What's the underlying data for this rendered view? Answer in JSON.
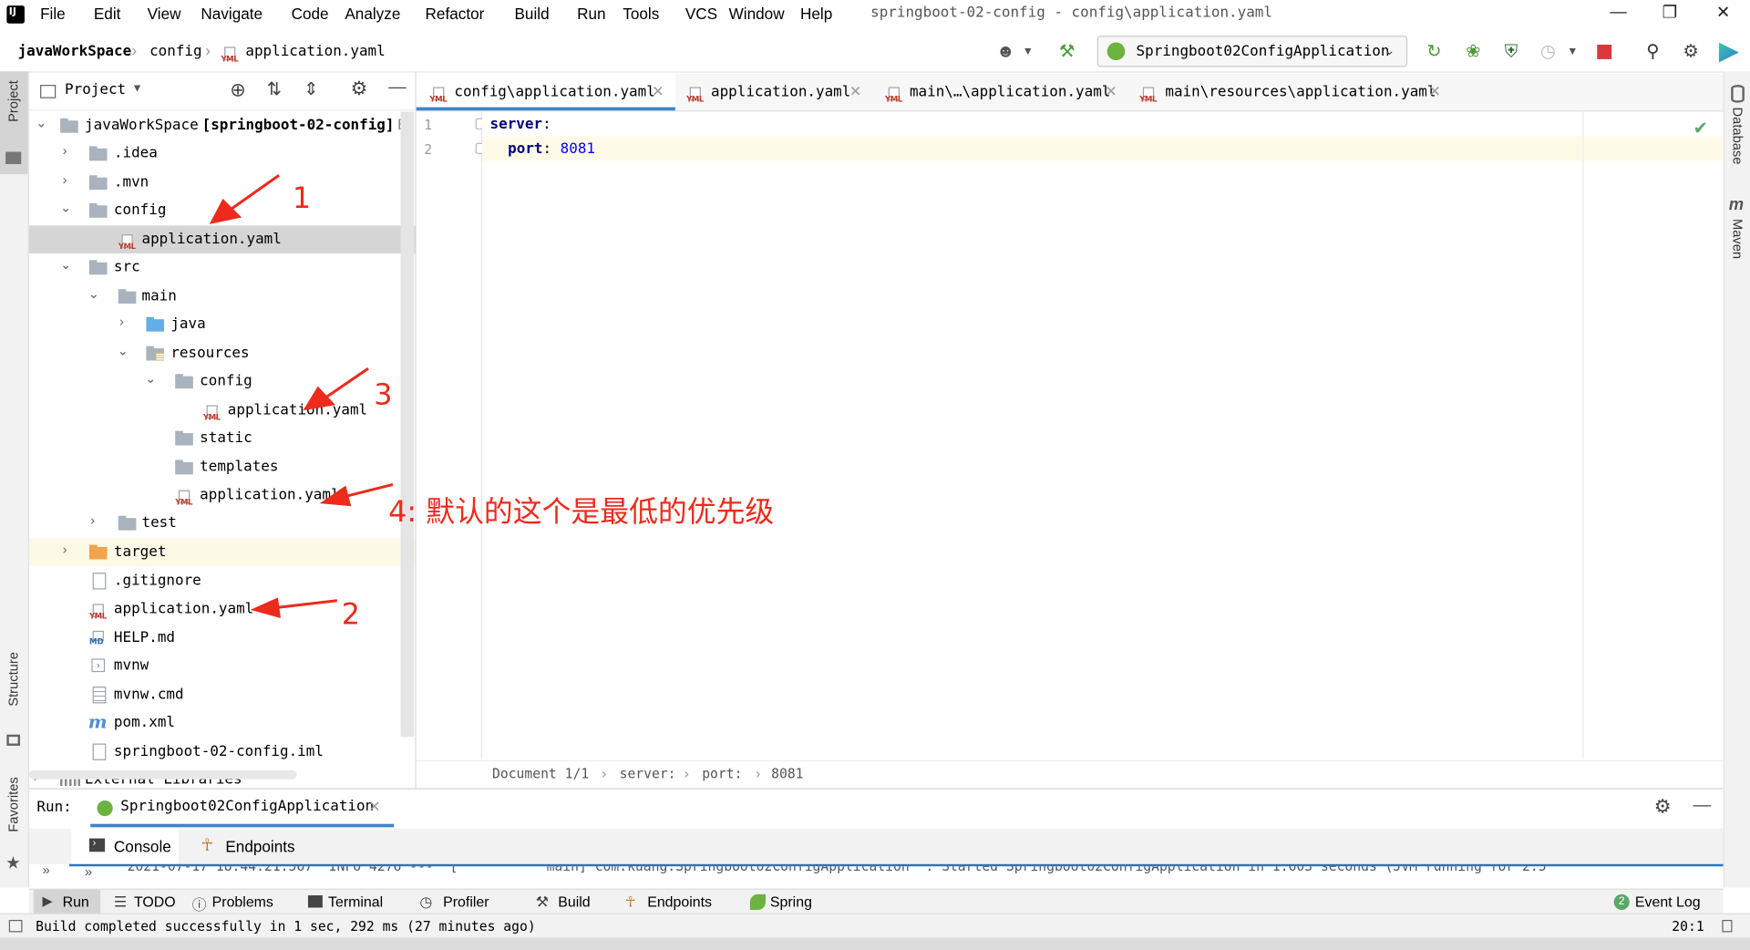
{
  "menubar": {
    "items": [
      "File",
      "Edit",
      "View",
      "Navigate",
      "Code",
      "Analyze",
      "Refactor",
      "Build",
      "Run",
      "Tools",
      "VCS",
      "Window",
      "Help"
    ],
    "window_title": "springboot-02-config - config\\application.yaml"
  },
  "navbar": {
    "crumbs": [
      "javaWorkSpace",
      "config",
      "application.yaml"
    ],
    "run_config": "Springboot02ConfigApplication"
  },
  "left_stripe": {
    "project": "Project",
    "structure": "Structure",
    "favorites": "Favorites"
  },
  "right_stripe": {
    "database": "Database",
    "maven": "Maven"
  },
  "project_panel": {
    "title": "Project",
    "root_name": "javaWorkSpace",
    "root_module": "[springboot-02-config]",
    "root_suffix": "E:",
    "nodes": [
      {
        "label": ".idea"
      },
      {
        "label": ".mvn"
      },
      {
        "label": "config"
      },
      {
        "label": "application.yaml"
      },
      {
        "label": "src"
      },
      {
        "label": "main"
      },
      {
        "label": "java"
      },
      {
        "label": "resources"
      },
      {
        "label": "config"
      },
      {
        "label": "application.yaml"
      },
      {
        "label": "static"
      },
      {
        "label": "templates"
      },
      {
        "label": "application.yaml"
      },
      {
        "label": "test"
      },
      {
        "label": "target"
      },
      {
        "label": ".gitignore"
      },
      {
        "label": "application.yaml"
      },
      {
        "label": "HELP.md"
      },
      {
        "label": "mvnw"
      },
      {
        "label": "mvnw.cmd"
      },
      {
        "label": "pom.xml"
      },
      {
        "label": "springboot-02-config.iml"
      },
      {
        "label": "External Libraries"
      }
    ]
  },
  "tabs": [
    "config\\application.yaml",
    "application.yaml",
    "main\\…\\application.yaml",
    "main\\resources\\application.yaml"
  ],
  "editor": {
    "line_numbers": [
      "1",
      "2"
    ],
    "line1_key": "server",
    "line2_key": "port",
    "line2_value": "8081",
    "colon": ":"
  },
  "editor_status": [
    "Document 1/1",
    "server:",
    "port:",
    "8081"
  ],
  "run_panel": {
    "label": "Run:",
    "config": "Springboot02ConfigApplication",
    "tabs": [
      "Console",
      "Endpoints"
    ],
    "console_line": "2021-07-17 18:44:21.567  INFO 4276 ---  [           main] com.kuang.Springboot02ConfigApplication  : Started Springboot02ConfigApplication in 1.603 seconds (JVM running for 2.5"
  },
  "bottom_toolbar": {
    "items": [
      "Run",
      "TODO",
      "Problems",
      "Terminal",
      "Profiler",
      "Build",
      "Endpoints",
      "Spring"
    ],
    "event_log": "Event Log",
    "event_count": "2"
  },
  "status_bar": {
    "message": "Build completed successfully in 1 sec, 292 ms (27 minutes ago)",
    "position": "20:1"
  },
  "annotations": {
    "a1": "1",
    "a2": "2",
    "a3": "3",
    "a4": "4:  默认的这个是最低的优先级"
  },
  "colors": {
    "accent": "#2475c4",
    "annotation": "#ee2a1c",
    "yaml_key": "#000080",
    "yaml_number": "#0000ff",
    "success": "#59a869"
  }
}
